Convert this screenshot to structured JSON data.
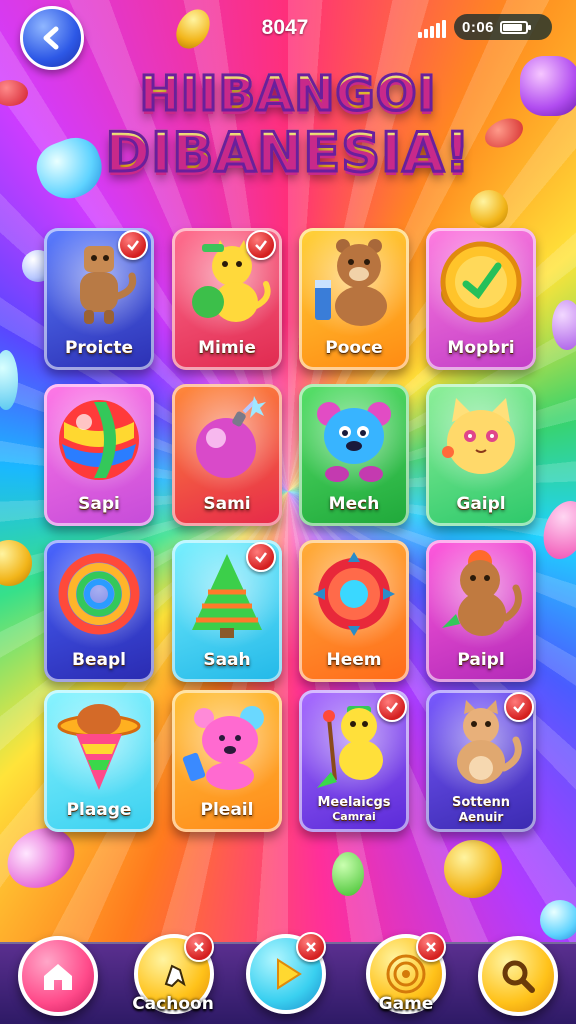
{
  "header": {
    "score": "8047",
    "time": "0:06"
  },
  "title": {
    "line1": "HIIBANGOI",
    "line2": "DIBANESIA!"
  },
  "cards": [
    {
      "label": "Proicte",
      "badge": "check",
      "art": "dog-figure"
    },
    {
      "label": "Mimie",
      "badge": "check",
      "art": "cat-with-ball"
    },
    {
      "label": "Pooce",
      "badge": "none",
      "art": "bear-with-cup"
    },
    {
      "label": "Mopbri",
      "badge": "none",
      "art": "gold-coin-check"
    },
    {
      "label": "Sapi",
      "badge": "none",
      "art": "striped-ball"
    },
    {
      "label": "Sami",
      "badge": "none",
      "art": "bomb"
    },
    {
      "label": "Mech",
      "badge": "none",
      "art": "blue-bear"
    },
    {
      "label": "Gaipl",
      "badge": "none",
      "art": "yellow-cat"
    },
    {
      "label": "Beapl",
      "badge": "none",
      "art": "rainbow-ring"
    },
    {
      "label": "Saah",
      "badge": "check",
      "art": "green-tree"
    },
    {
      "label": "Heem",
      "badge": "none",
      "art": "red-target"
    },
    {
      "label": "Paipl",
      "badge": "none",
      "art": "brown-cat"
    },
    {
      "label": "Plaage",
      "badge": "none",
      "art": "ice-cream-cone"
    },
    {
      "label": "Pleail",
      "badge": "none",
      "art": "pink-bear"
    },
    {
      "label": "Meelaicgs\nCamrai",
      "badge": "check",
      "art": "cat-with-wand"
    },
    {
      "label": "Sottenn\nAenuir",
      "badge": "check",
      "art": "tan-cat"
    }
  ],
  "nav": {
    "item1_label": "",
    "item2_label": "Cachoon",
    "item3_label": "",
    "item4_label": "Game",
    "item5_label": ""
  }
}
